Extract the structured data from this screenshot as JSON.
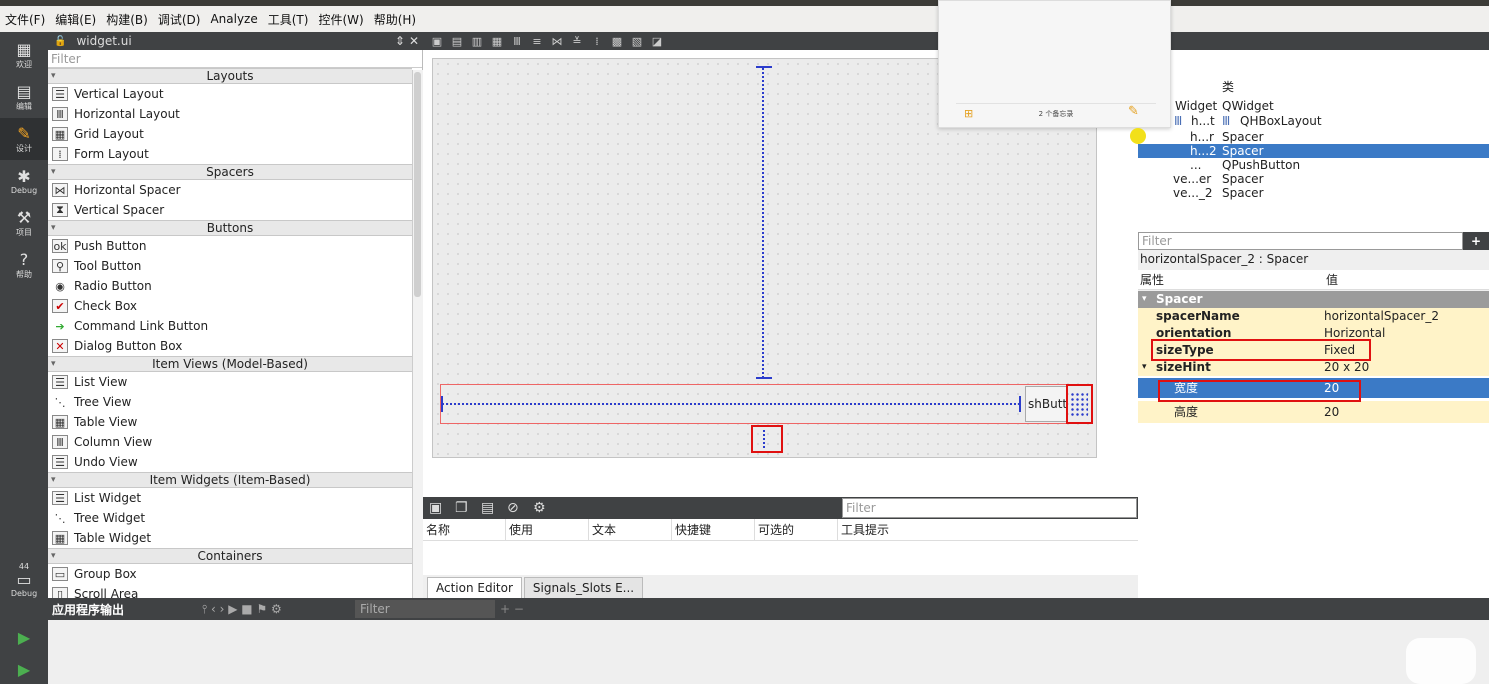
{
  "menubar": [
    "文件(F)",
    "编辑(E)",
    "构建(B)",
    "调试(D)",
    "Analyze",
    "工具(T)",
    "控件(W)",
    "帮助(H)"
  ],
  "modes": [
    {
      "label": "欢迎",
      "icon": "grid-icon"
    },
    {
      "label": "编辑",
      "icon": "edit-icon"
    },
    {
      "label": "设计",
      "icon": "pencil-icon"
    },
    {
      "label": "Debug",
      "icon": "bug-icon"
    },
    {
      "label": "项目",
      "icon": "wrench-icon"
    },
    {
      "label": "帮助",
      "icon": "help-icon"
    }
  ],
  "kit": {
    "number": "44",
    "label": "Debug"
  },
  "editor": {
    "file_name": "widget.ui"
  },
  "widgetbox": {
    "filter_placeholder": "Filter",
    "categories": [
      {
        "name": "Layouts",
        "items": [
          "Vertical Layout",
          "Horizontal Layout",
          "Grid Layout",
          "Form Layout"
        ]
      },
      {
        "name": "Spacers",
        "items": [
          "Horizontal Spacer",
          "Vertical Spacer"
        ]
      },
      {
        "name": "Buttons",
        "items": [
          "Push Button",
          "Tool Button",
          "Radio Button",
          "Check Box",
          "Command Link Button",
          "Dialog Button Box"
        ]
      },
      {
        "name": "Item Views (Model-Based)",
        "items": [
          "List View",
          "Tree View",
          "Table View",
          "Column View",
          "Undo View"
        ]
      },
      {
        "name": "Item Widgets (Item-Based)",
        "items": [
          "List Widget",
          "Tree Widget",
          "Table Widget"
        ]
      },
      {
        "name": "Containers",
        "items": [
          "Group Box",
          "Scroll Area"
        ]
      }
    ]
  },
  "form": {
    "push_button_text": "shButt"
  },
  "action_editor": {
    "filter_placeholder": "Filter",
    "columns": [
      "名称",
      "使用",
      "文本",
      "快捷键",
      "可选的",
      "工具提示"
    ],
    "tabs": [
      "Action Editor",
      "Signals_Slots E..."
    ]
  },
  "object_inspector": {
    "header": "类",
    "rows": [
      {
        "name": "Widget",
        "cls": "QWidget",
        "indent": 0
      },
      {
        "name": "h...t",
        "cls": "QHBoxLayout",
        "indent": 1
      },
      {
        "name": "h...r",
        "cls": "Spacer",
        "indent": 2
      },
      {
        "name": "h...2",
        "cls": "Spacer",
        "indent": 2,
        "selected": true
      },
      {
        "name": "...",
        "cls": "QPushButton",
        "indent": 2
      },
      {
        "name": "ve...er",
        "cls": "Spacer",
        "indent": 1
      },
      {
        "name": "ve..._2",
        "cls": "Spacer",
        "indent": 1
      }
    ]
  },
  "property_editor": {
    "filter_placeholder": "Filter",
    "object_name": "horizontalSpacer_2 : Spacer",
    "col_property": "属性",
    "col_value": "值",
    "group": "Spacer",
    "rows": [
      {
        "name": "spacerName",
        "value": "horizontalSpacer_2"
      },
      {
        "name": "orientation",
        "value": "Horizontal"
      },
      {
        "name": "sizeType",
        "value": "Fixed"
      },
      {
        "name": "sizeHint",
        "value": "20 x 20"
      },
      {
        "name": "宽度",
        "value": "20"
      },
      {
        "name": "高度",
        "value": "20"
      }
    ]
  },
  "popup": {
    "caption": "2 个备忘录"
  },
  "output": {
    "title": "应用程序输出",
    "filter_placeholder": "Filter"
  }
}
